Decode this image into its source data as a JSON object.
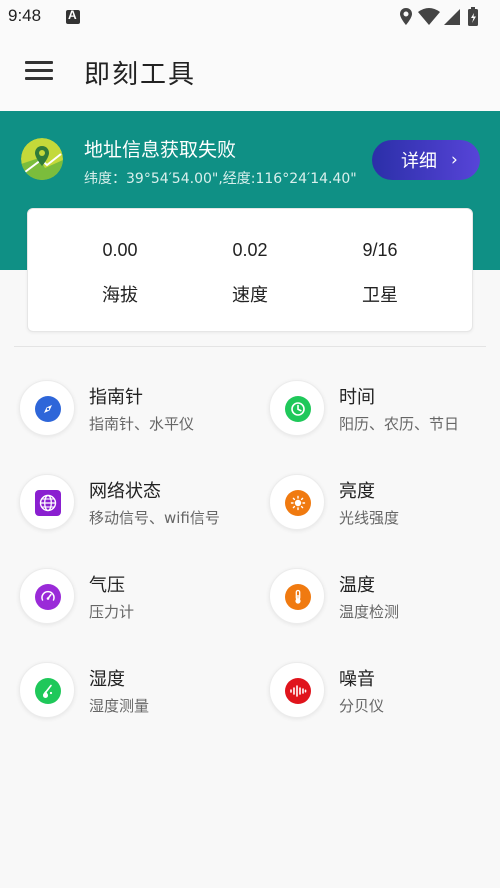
{
  "status_bar": {
    "time": "9:48"
  },
  "app_bar": {
    "title": "即刻工具"
  },
  "location": {
    "title": "地址信息获取失败",
    "coords": "纬度：39°54′54.00\",经度:116°24′14.40\"",
    "detail_label": "详细",
    "detail_chevron": "›"
  },
  "stats": [
    {
      "value": "0.00",
      "label": "海拔"
    },
    {
      "value": "0.02",
      "label": "速度"
    },
    {
      "value": "9/16",
      "label": "卫星"
    }
  ],
  "tools": [
    {
      "name": "指南针",
      "sub": "指南针、水平仪",
      "icon": "compass-icon",
      "color": "#2e66d9"
    },
    {
      "name": "时间",
      "sub": "阳历、农历、节日",
      "icon": "clock-icon",
      "color": "#1fc85a"
    },
    {
      "name": "网络状态",
      "sub": "移动信号、wifi信号",
      "icon": "globe-icon",
      "color": "#8a1fd0"
    },
    {
      "name": "亮度",
      "sub": "光线强度",
      "icon": "brightness-icon",
      "color": "#f07a10"
    },
    {
      "name": "气压",
      "sub": "压力计",
      "icon": "gauge-icon",
      "color": "#9a2ad8"
    },
    {
      "name": "温度",
      "sub": "温度检测",
      "icon": "thermometer-icon",
      "color": "#f07a10"
    },
    {
      "name": "湿度",
      "sub": "湿度测量",
      "icon": "humidity-icon",
      "color": "#1fc85a"
    },
    {
      "name": "噪音",
      "sub": "分贝仪",
      "icon": "sound-wave-icon",
      "color": "#e0141c"
    }
  ],
  "colors": {
    "banner": "#0f9085",
    "detail_button": "#3c39c0"
  }
}
